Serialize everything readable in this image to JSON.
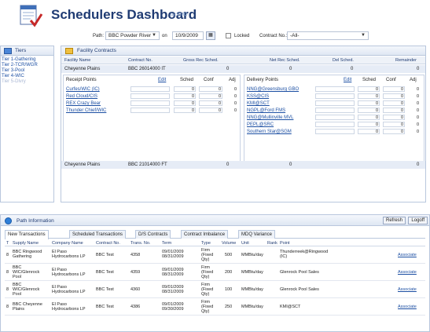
{
  "app": {
    "title": "Schedulers Dashboard",
    "byline": "by EMO",
    "colors": {
      "title": "#1f3b73",
      "link": "#1c4fa3",
      "panel_border": "#b9c7dd"
    }
  },
  "filters": {
    "path_label": "Path:",
    "path_value": "BBC Powder River",
    "on_label": "on",
    "date_value": "10/9/2009",
    "locked_label": "Locked",
    "contract_label": "Contract No.:",
    "contract_value": "-All-"
  },
  "tiers": {
    "title": "Tiers",
    "items": [
      {
        "label": "Tier 1-Gathering",
        "muted": false
      },
      {
        "label": "Tier 2-TCR/WGR",
        "muted": false
      },
      {
        "label": "Tier 3-Pool",
        "muted": false
      },
      {
        "label": "Tier 4-WIC",
        "muted": false
      },
      {
        "label": "Tier 5-Dlvry",
        "muted": true
      }
    ]
  },
  "contracts": {
    "title": "Facility Contracts",
    "columns": [
      "Facility Name",
      "Contract No.",
      "Gross Rec Sched.",
      "Net Rec Sched.",
      "Del Sched.",
      "Remainder"
    ],
    "rows": [
      {
        "facility": "Cheyenne Plains",
        "contract": "BBC 26014000 IT",
        "gross": "0",
        "net": "0",
        "del": "0",
        "remainder": "0"
      },
      {
        "facility": "Cheyenne Plains",
        "contract": "BBC 21014000 FT",
        "gross": "0",
        "net": "0",
        "del": "",
        "remainder": "0"
      }
    ],
    "receipt": {
      "title": "Receipt Points",
      "edit": "Edit",
      "cols": [
        "Sched",
        "Conf",
        "Adj"
      ],
      "points": [
        {
          "name": "Curfes/WIC (IC)",
          "sched": "0",
          "conf": "0",
          "adj": "0"
        },
        {
          "name": "Red Cloud/CIS",
          "sched": "0",
          "conf": "0",
          "adj": "0"
        },
        {
          "name": "REX Crazy Bear",
          "sched": "0",
          "conf": "0",
          "adj": "0"
        },
        {
          "name": "Thunder Chief/WIC",
          "sched": "0",
          "conf": "0",
          "adj": "0"
        }
      ]
    },
    "delivery": {
      "title": "Delivery Points",
      "edit": "Edit",
      "cols": [
        "Sched",
        "Conf",
        "Adj"
      ],
      "points": [
        {
          "name": "NNG@Greensburg GBO",
          "sched": "0",
          "conf": "0",
          "adj": "0"
        },
        {
          "name": "KSS@CIS",
          "sched": "0",
          "conf": "0",
          "adj": "0"
        },
        {
          "name": "KMI@SCT",
          "sched": "0",
          "conf": "0",
          "adj": "0"
        },
        {
          "name": "NGPL@Ford FMS",
          "sched": "0",
          "conf": "0",
          "adj": "0"
        },
        {
          "name": "NNG@Mullinville MVL",
          "sched": "0",
          "conf": "0",
          "adj": "0"
        },
        {
          "name": "PEPL@SRC",
          "sched": "0",
          "conf": "0",
          "adj": "0"
        },
        {
          "name": "Southern Star@SGM",
          "sched": "0",
          "conf": "0",
          "adj": "0"
        }
      ]
    }
  },
  "path_info": {
    "title": "Path Information",
    "refresh": "Refresh",
    "logoff": "Logoff",
    "tabs": [
      "New Transactions",
      "Scheduled Transactions",
      "D/S Contracts",
      "Contract Imbalance",
      "MDQ Variance"
    ],
    "columns": [
      "T",
      "Supply Name",
      "Company Name",
      "Contract No.",
      "Trans. No.",
      "Term",
      "Type",
      "Volume",
      "Unit",
      "Rank",
      "Point",
      ""
    ],
    "rows": [
      {
        "t": "8",
        "supply": [
          "BBC Ringwood",
          "Gathering"
        ],
        "company": [
          "El Paso",
          "Hydrocarbons LP"
        ],
        "contract": "BBC Test",
        "trans": "4358",
        "term": [
          "09/01/2009",
          "08/31/2009"
        ],
        "type": [
          "Firm",
          "(Fixed",
          "Qty)"
        ],
        "volume": "500",
        "unit": "MMBtu/day",
        "rank": "",
        "point": [
          "Thunderreek@Ringwood",
          "(IC)"
        ],
        "action": "Associate"
      },
      {
        "t": "8",
        "supply": [
          "BBC",
          "WIC/Glenrock",
          "Pool"
        ],
        "company": [
          "El Paso",
          "Hydrocarbons LP"
        ],
        "contract": "BBC Test",
        "trans": "4359",
        "term": [
          "09/01/2009",
          "08/31/2009"
        ],
        "type": [
          "Firm",
          "(Fixed",
          "Qty)"
        ],
        "volume": "200",
        "unit": "MMBtu/day",
        "rank": "",
        "point": [
          "Glenrock Pool Sales"
        ],
        "action": "Associate"
      },
      {
        "t": "8",
        "supply": [
          "BBC",
          "WIC/Glenrock",
          "Pool"
        ],
        "company": [
          "El Paso",
          "Hydrocarbons LP"
        ],
        "contract": "BBC Test",
        "trans": "4360",
        "term": [
          "09/01/2009",
          "08/31/2009"
        ],
        "type": [
          "Firm",
          "(Fixed",
          "Qty)"
        ],
        "volume": "100",
        "unit": "MMBtu/day",
        "rank": "",
        "point": [
          "Glenrock Pool Sales"
        ],
        "action": "Associate"
      },
      {
        "t": "8",
        "supply": [
          "BBC Cheyenne",
          "Plains"
        ],
        "company": [
          "El Paso",
          "Hydrocarbons LP"
        ],
        "contract": "BBC Test",
        "trans": "4386",
        "term": [
          "09/01/2009",
          "09/30/2009"
        ],
        "type": [
          "Firm",
          "(Fixed",
          "Qty)"
        ],
        "volume": "250",
        "unit": "MMBtu/day",
        "rank": "",
        "point": [
          "KMI@SCT"
        ],
        "action": "Associate"
      }
    ]
  }
}
